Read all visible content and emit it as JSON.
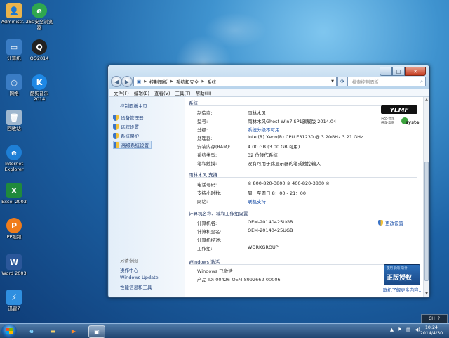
{
  "desktop": {
    "icons": [
      {
        "label": "Administr...",
        "icon": "user-folder-icon",
        "color": "#e9b44c"
      },
      {
        "label": "360安全浏览器",
        "icon": "360-browser-icon",
        "color": "#2fa84f"
      },
      {
        "label": "计算机",
        "icon": "computer-icon",
        "color": "#3a7cc4"
      },
      {
        "label": "QQ2014",
        "icon": "qq-penguin-icon",
        "color": "#222222"
      },
      {
        "label": "网络",
        "icon": "network-icon",
        "color": "#3a7cc4"
      },
      {
        "label": "酷狗音乐2014",
        "icon": "kugou-music-icon",
        "color": "#1e88e5"
      },
      {
        "label": "回收站",
        "icon": "recycle-bin-icon",
        "color": "#9fb7cf"
      },
      {
        "label": "Internet Explorer",
        "icon": "internet-explorer-icon",
        "color": "#1e7fd6"
      },
      {
        "label": "Excel 2003",
        "icon": "excel-icon",
        "color": "#1f8a3c"
      },
      {
        "label": "PP视频",
        "icon": "pptv-icon",
        "color": "#f07c1b"
      },
      {
        "label": "Word 2003",
        "icon": "word-icon",
        "color": "#2b579a"
      },
      {
        "label": "迅雷7",
        "icon": "thunder-icon",
        "color": "#2f8fe0"
      }
    ]
  },
  "window": {
    "breadcrumb": [
      "控制面板",
      "系统和安全",
      "系统"
    ],
    "search_placeholder": "搜索控制面板",
    "menu": [
      "文件(F)",
      "编辑(E)",
      "查看(V)",
      "工具(T)",
      "帮助(H)"
    ],
    "sidebar": {
      "home": "控制面板主页",
      "links": [
        "设备管理器",
        "远程设置",
        "系统保护",
        "高级系统设置"
      ],
      "see_also_title": "另请参阅",
      "see_also": [
        "操作中心",
        "Windows Update",
        "性能信息和工具"
      ]
    },
    "system": {
      "section_title": "系统",
      "rows": [
        {
          "label": "制造商:",
          "value": "雨林木风"
        },
        {
          "label": "型号:",
          "value": "雨林木风Ghost Win7 SP1旗舰版 2014.04"
        },
        {
          "label": "分级:",
          "value": "系统分级不可用"
        },
        {
          "label": "处理器:",
          "value": "Intel(R) Xeon(R) CPU E31230 @ 3.20GHz   3.21 GHz"
        },
        {
          "label": "安装内存(RAM):",
          "value": "4.00 GB (3.00 GB 可用)"
        },
        {
          "label": "系统类型:",
          "value": "32 位操作系统"
        },
        {
          "label": "笔和触摸:",
          "value": "没有可用于此显示器的笔或触控输入"
        }
      ],
      "logo_text": "YLMF",
      "logo_sub1": "安全·稳定",
      "logo_sub2": "纯净·高效",
      "logo_brand": "system"
    },
    "support": {
      "section_title": "雨林木风 支持",
      "rows": [
        {
          "label": "电话号码:",
          "value": "※ 800-820-3800 ※ 400-820-3800 ※"
        },
        {
          "label": "支持小时数:",
          "value": "周一至周日 8：00 - 21：00"
        },
        {
          "label": "网站:",
          "value": "联机支持"
        }
      ]
    },
    "computer": {
      "section_title": "计算机名称、域和工作组设置",
      "rows": [
        {
          "label": "计算机名:",
          "value": "OEM-20140425UGB"
        },
        {
          "label": "计算机全名:",
          "value": "OEM-20140425UGB"
        },
        {
          "label": "计算机描述:",
          "value": ""
        },
        {
          "label": "工作组:",
          "value": "WORKGROUP"
        }
      ],
      "change_label": "更改设置"
    },
    "activation": {
      "section_title": "Windows 激活",
      "status": "Windows 已激活",
      "product_id": "产品 ID: 00426-OEM-8992662-00006",
      "badge_small": "使用 微软 软件",
      "badge_big": "正版授权",
      "more_link": "联机了解更多内容..."
    }
  },
  "taskbar": {
    "items": [
      "internet-explorer-icon",
      "file-explorer-icon",
      "media-player-icon",
      "control-panel-icon"
    ],
    "lang": "CH",
    "time": "10:24",
    "date": "2014/4/30"
  }
}
